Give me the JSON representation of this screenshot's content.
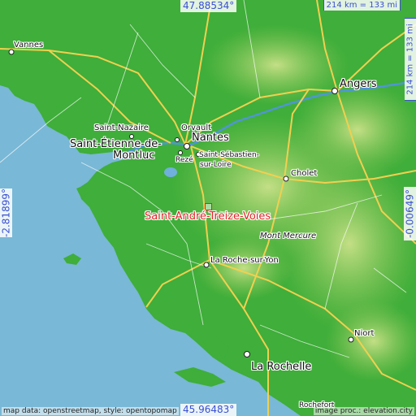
{
  "map": {
    "coordinates": {
      "north": "47.88534°",
      "south": "45.96483°",
      "west": "-2.81899°",
      "east": "-0.00649°"
    },
    "scale": {
      "horizontal": "214 km = 133 mi",
      "vertical": "214 km = 133 mi"
    },
    "focus_place": "Saint-André-Treize-Voies",
    "places": {
      "vannes": "Vannes",
      "angers": "Angers",
      "orvault": "Orvault",
      "nantes": "Nantes",
      "saint_nazaire": "Saint-Nazaire",
      "saint_etienne_1": "Saint-Étienne-de-",
      "saint_etienne_2": "Montluc",
      "reze": "Rezé",
      "saint_sebastien_1": "Saint-Sébastien-",
      "saint_sebastien_2": "sur-Loire",
      "cholet": "Cholet",
      "mont_mercure": "Mont Mercure",
      "la_roche": "La Roche-sur-Yon",
      "niort": "Niort",
      "la_rochelle": "La Rochelle",
      "rochefort": "Rochefort"
    },
    "attribution_left": "map data: openstreetmap, style: opentopomap",
    "attribution_right": "image proc.: elevation.city",
    "colors": {
      "sea": "#79b8d6",
      "lowland": "#3fae3a",
      "upland": "#a9d46a",
      "accent_text": "#3a4fd0",
      "focus": "#e0232a"
    }
  }
}
